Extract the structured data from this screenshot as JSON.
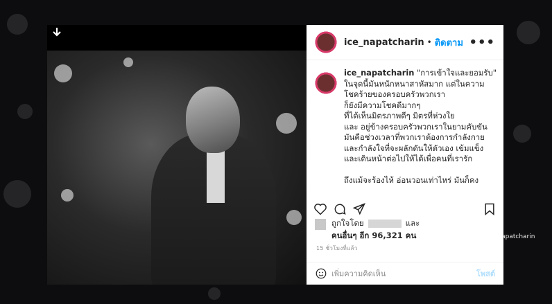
{
  "header": {
    "username": "ice_napatcharin",
    "separator": "•",
    "follow_label": "ติดตาม",
    "more_label": "•••"
  },
  "caption": {
    "username": "ice_napatcharin",
    "text": "\"การเข้าใจและยอมรับ\"\nในจุดนี้มันหนักหนาสาหัสมาก แต่ในความโชคร้ายของครอบครัวพวกเรา\nก็ยังมีความโชคดีมากๆ\nที่ได้เห็นมิตรภาพดีๆ มิตรที่ห่วงใย\nและ อยู่ข้างครอบครัวพวกเราในยามคับขัน\nมันคือช่วงเวลาที่พวกเราต้องการกำลังกาย\nและกำลังใจที่จะผลักดันให้ตัวเอง เข้มแข็ง\nและเดินหน้าต่อไปให้ได้เพื่อคนที่เรารัก\n\nถึงแม้จะร้องไห้ อ่อนวอนเท่าไหร่ มันก็คง"
  },
  "likes": {
    "prefix": "ถูกใจโดย",
    "and": "และ",
    "others": "คนอื่นๆ อีก 96,321 คน"
  },
  "time_ago": "15 ชั่วโมงที่แล้ว",
  "comment": {
    "placeholder": "เพิ่มความคิดเห็น",
    "post_label": "โพสต์"
  },
  "credit": "ขอบคุณภาพ IG ice_napatcharin",
  "icons": [
    "download-icon",
    "heart-icon",
    "comment-icon",
    "share-icon",
    "bookmark-icon",
    "smile-icon"
  ],
  "colors": {
    "follow": "#0095f6",
    "post_disabled": "#b2dffc",
    "muted": "#8e8e8e"
  }
}
